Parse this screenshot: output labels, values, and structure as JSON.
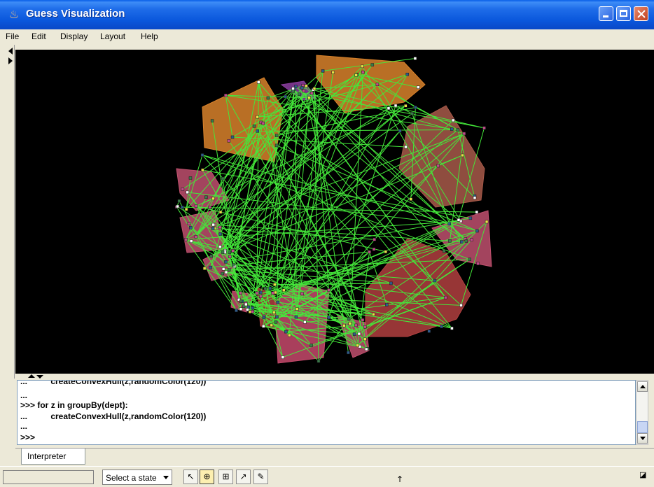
{
  "window": {
    "title": "Guess Visualization",
    "icon": "java-cup-icon"
  },
  "menu": [
    "File",
    "Edit",
    "Display",
    "Layout",
    "Help"
  ],
  "console": {
    "lines": [
      "...          createConvexHull(z,randomColor(120))",
      "...",
      ">>> for z in groupBy(dept):",
      "...          createConvexHull(z,randomColor(120))",
      "...",
      ">>>"
    ]
  },
  "tabs": [
    "Interpreter"
  ],
  "toolbar": {
    "state_select": "Select a state",
    "tools": [
      "pointer-icon",
      "zoom-select-icon",
      "node-edit-icon",
      "edge-edit-icon",
      "layout-brush-icon"
    ]
  },
  "colors": {
    "edge": "#44e83a",
    "background": "#000000",
    "hulls": [
      "#d9822b",
      "#c0506e",
      "#8b3ea0",
      "#a85a4a",
      "#b24040",
      "#c74a6c"
    ]
  }
}
